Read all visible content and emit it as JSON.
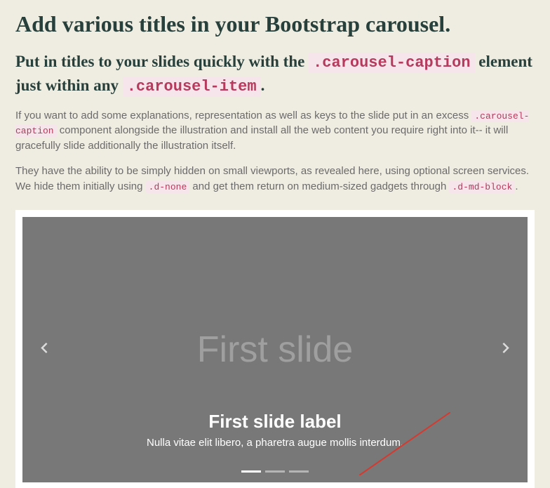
{
  "heading": "Add various titles in your Bootstrap carousel.",
  "sub": {
    "part1": "Put in titles to your slides quickly with the ",
    "code1": ".carousel-caption",
    "part2": " element just within any ",
    "code2": ".carousel-item",
    "part3": "."
  },
  "para1": {
    "a": "If you want to add some explanations, representation as well as keys to the slide put in an excess ",
    "code": ".carousel-caption",
    "b": " component alongside the illustration and install all the web content you require right into it-- it will gracefully slide additionally the illustration itself."
  },
  "para2": {
    "a": "They have the ability to be simply hidden on small viewports, as revealed here, using optional screen services. We hide them initially using ",
    "code1": ".d-none",
    "b": " and get them return on medium-sized gadgets through ",
    "code2": ".d-md-block",
    "c": "."
  },
  "carousel": {
    "placeholder": "First slide",
    "caption_title": "First slide label",
    "caption_text": "Nulla vitae elit libero, a pharetra augue mollis interdum.",
    "active_index": 0,
    "count": 3
  }
}
